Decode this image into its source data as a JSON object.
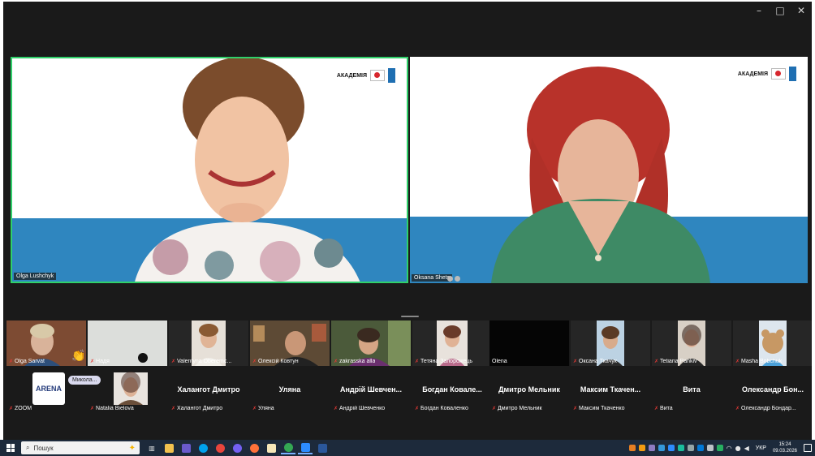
{
  "window": {
    "minimize": "–",
    "maximize": "□",
    "close": "✕"
  },
  "speakers": [
    {
      "name": "Olga Lushchyk",
      "logo_word": "АКАДЕМІЯ"
    },
    {
      "name": "Oksana Shets",
      "logo_word": "АКАДЕМІЯ"
    }
  ],
  "gallery_row1": [
    {
      "name": "Olga Sarvat",
      "muted": true
    },
    {
      "name": "Надя",
      "muted": true
    },
    {
      "name": "Valentyna Oberemc...",
      "muted": true
    },
    {
      "name": "Олексій Ковтун",
      "muted": true
    },
    {
      "name": "zakrasska alla",
      "muted": true
    },
    {
      "name": "Тетяна Запорожець",
      "muted": true
    },
    {
      "name": "Olena",
      "muted": false
    },
    {
      "name": "Оксана Ткачук",
      "muted": true
    },
    {
      "name": "Tetiana Pankiv",
      "muted": true
    },
    {
      "name": "Masha Bobchuk",
      "muted": true
    }
  ],
  "gallery_row2": [
    {
      "name": "ZOOM",
      "big_name": "",
      "muted": true
    },
    {
      "name": "Natalia Bielova",
      "big_name": "",
      "muted": true
    },
    {
      "name": "Халангот Дмитро",
      "big_name": "Халангот Дмитро",
      "muted": true
    },
    {
      "name": "Уляна",
      "big_name": "Уляна",
      "muted": true
    },
    {
      "name": "Андрій Шевченко",
      "big_name": "Андрій Шевчен...",
      "muted": true
    },
    {
      "name": "Богдан Коваленко",
      "big_name": "Богдан Ковале...",
      "muted": true
    },
    {
      "name": "Дмитро Мельник",
      "big_name": "Дмитро Мельник",
      "muted": true
    },
    {
      "name": "Максим Ткаченко",
      "big_name": "Максим Ткачен...",
      "muted": true
    },
    {
      "name": "Вита",
      "big_name": "Вита",
      "muted": true
    },
    {
      "name": "Олександр Бондар...",
      "big_name": "Олександр Бон...",
      "muted": true
    }
  ],
  "zoom_tile_logo": "ARENA",
  "tooltip": "Микола...",
  "reaction": "👏",
  "taskbar": {
    "search_placeholder": "Пошук",
    "language": "УКР",
    "time": "15:24",
    "date": "09.03.2026"
  },
  "colors": {
    "active_speaker_border": "#2fd06a",
    "backdrop_blue": "#2f86bf",
    "taskbar_bg": "#1d2a3b",
    "mic_off": "#e53935"
  }
}
